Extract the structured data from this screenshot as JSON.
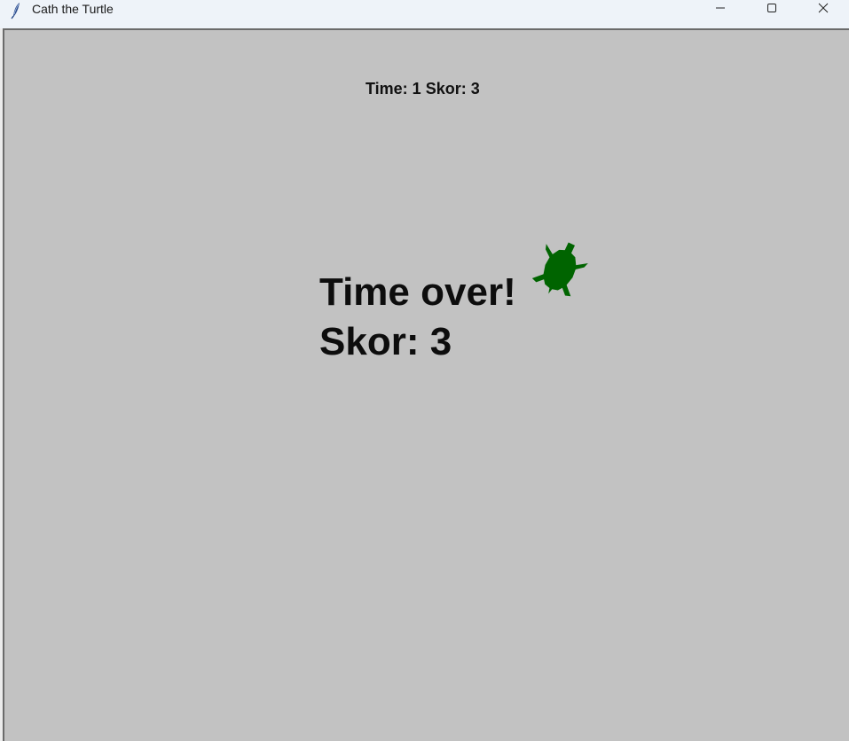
{
  "window": {
    "title": "Cath the Turtle",
    "icon": "feather-icon",
    "controls": [
      "minimize-icon",
      "maximize-icon",
      "close-icon"
    ]
  },
  "hud": {
    "text": "Time: 1 Skor: 3"
  },
  "game_over": {
    "line1": "Time over!",
    "line2": "Skor: 3"
  },
  "turtle": {
    "icon": "turtle-icon",
    "color": "#006400"
  },
  "colors": {
    "canvas_bg": "#c2c2c2",
    "titlebar_bg": "#eef3f9",
    "text": "#111111"
  }
}
